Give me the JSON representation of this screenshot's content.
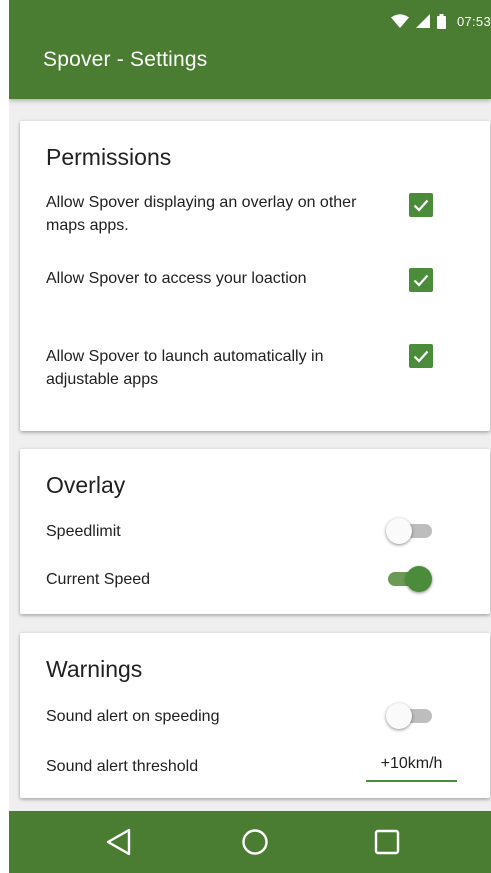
{
  "status_bar": {
    "time": "07:53",
    "icons": [
      "wifi-icon",
      "cell-signal-icon",
      "battery-icon"
    ]
  },
  "app_bar": {
    "title": "Spover - Settings"
  },
  "sections": {
    "permissions": {
      "title": "Permissions",
      "items": [
        {
          "label": "Allow Spover displaying an overlay on other maps apps.",
          "checked": true
        },
        {
          "label": "Allow Spover to access your loaction",
          "checked": true
        },
        {
          "label": "Allow Spover to launch automatically in adjustable apps",
          "checked": true
        }
      ]
    },
    "overlay": {
      "title": "Overlay",
      "items": [
        {
          "label": "Speedlimit",
          "on": false
        },
        {
          "label": "Current Speed",
          "on": true
        }
      ]
    },
    "warnings": {
      "title": "Warnings",
      "sound_alert": {
        "label": "Sound alert on speeding",
        "on": false
      },
      "threshold": {
        "label": "Sound alert threshold",
        "value": "+10km/h"
      }
    }
  },
  "nav_bar": {
    "buttons": [
      "back-icon",
      "home-icon",
      "recents-icon"
    ]
  },
  "colors": {
    "primary": "#4a7d32",
    "accent": "#4a8c3a",
    "background": "#efefef",
    "card": "#ffffff"
  }
}
